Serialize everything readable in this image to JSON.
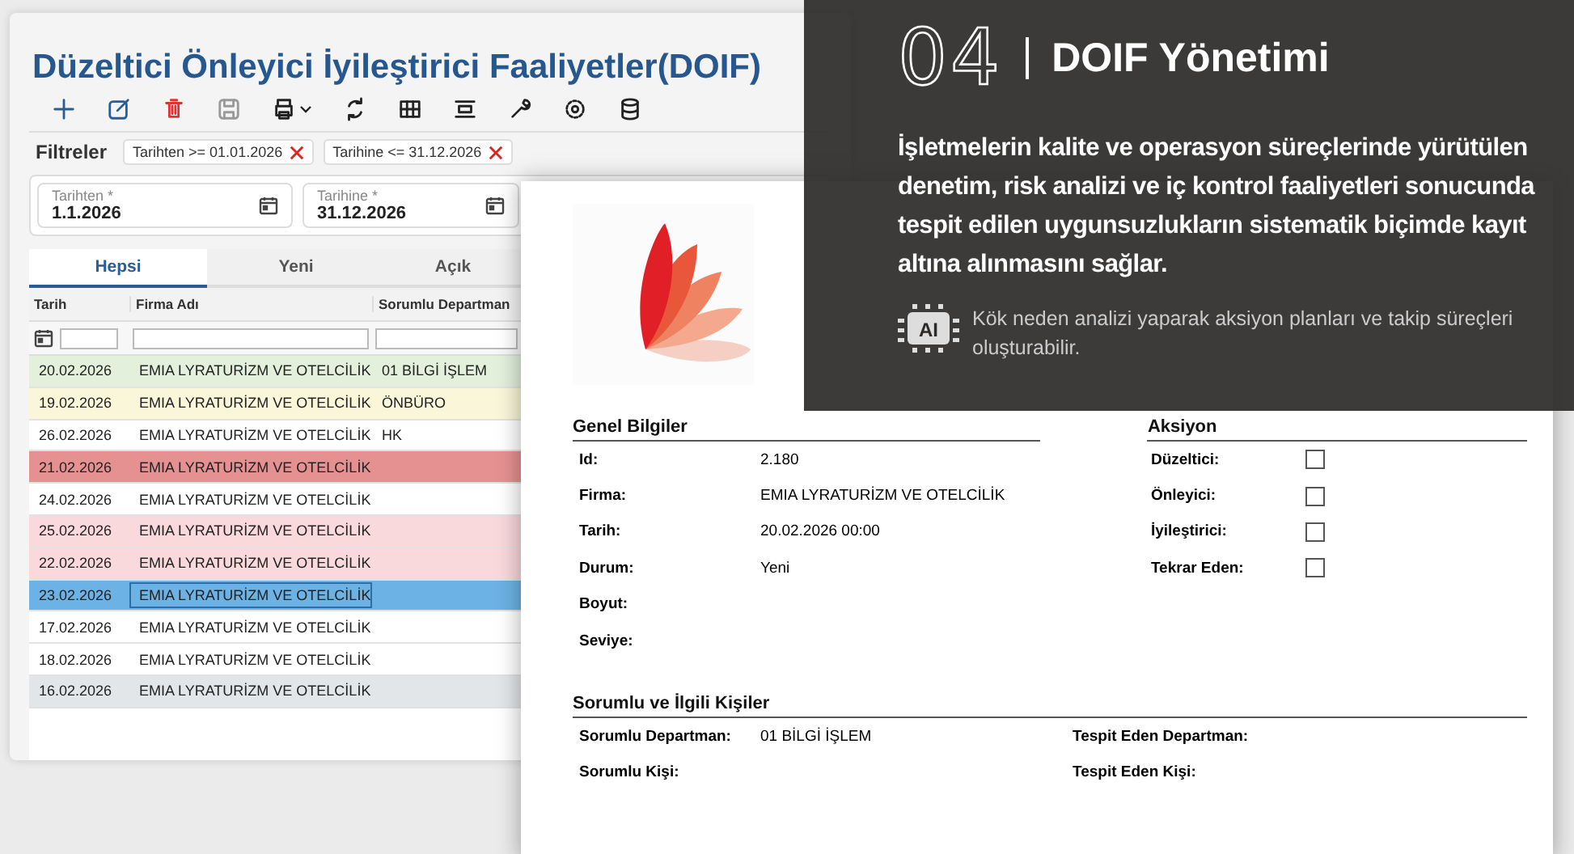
{
  "app": {
    "title": "Düzeltici Önleyici İyileştirici Faaliyetler(DOIF)",
    "filters_label": "Filtreler",
    "filter_chips": [
      "Tarihten >= 01.01.2026",
      "Tarihine <= 31.12.2026"
    ],
    "date_fields": [
      {
        "label": "Tarihten *",
        "value": "1.1.2026"
      },
      {
        "label": "Tarihine *",
        "value": "31.12.2026"
      }
    ],
    "tabs": [
      {
        "label": "Hepsi",
        "selected": true
      },
      {
        "label": "Yeni",
        "selected": false
      },
      {
        "label": "Açık",
        "selected": false
      }
    ],
    "table": {
      "columns": [
        "Tarih",
        "Firma Adı",
        "Sorumlu Departman"
      ],
      "rows": [
        {
          "date": "20.02.2026",
          "company": "EMIA LYRATURİZM VE OTELCİLİK",
          "department": "01 BİLGİ İŞLEM",
          "color": "#e2f0dc",
          "selected": false
        },
        {
          "date": "19.02.2026",
          "company": "EMIA LYRATURİZM VE OTELCİLİK",
          "department": "ÖNBÜRO",
          "color": "#faf6da",
          "selected": false
        },
        {
          "date": "26.02.2026",
          "company": "EMIA LYRATURİZM VE OTELCİLİK",
          "department": "HK",
          "color": "#ffffff",
          "selected": false
        },
        {
          "date": "21.02.2026",
          "company": "EMIA LYRATURİZM VE OTELCİLİK",
          "color": "#e69191",
          "selected": false
        },
        {
          "date": "24.02.2026",
          "company": "EMIA LYRATURİZM VE OTELCİLİK",
          "color": "#ffffff",
          "selected": false
        },
        {
          "date": "25.02.2026",
          "company": "EMIA LYRATURİZM VE OTELCİLİK",
          "color": "#f9d9dc",
          "selected": false
        },
        {
          "date": "22.02.2026",
          "company": "EMIA LYRATURİZM VE OTELCİLİK",
          "color": "#f9d9dc",
          "selected": false
        },
        {
          "date": "23.02.2026",
          "company": "EMIA LYRATURİZM VE OTELCİLİK",
          "color": "#6cb2e4",
          "selected": true
        },
        {
          "date": "17.02.2026",
          "company": "EMIA LYRATURİZM VE OTELCİLİK",
          "color": "#ffffff",
          "selected": false
        },
        {
          "date": "18.02.2026",
          "company": "EMIA LYRATURİZM VE OTELCİLİK",
          "color": "#ffffff",
          "selected": false
        },
        {
          "date": "16.02.2026",
          "company": "EMIA LYRATURİZM VE OTELCİLİK",
          "color": "#e3e6e9",
          "selected": false
        }
      ]
    }
  },
  "form": {
    "general": {
      "heading": "Genel Bilgiler",
      "fields": [
        {
          "label": "Id:",
          "value": "2.180"
        },
        {
          "label": "Firma:",
          "value": "EMIA LYRATURİZM VE OTELCİLİK"
        },
        {
          "label": "Tarih:",
          "value": "20.02.2026 00:00"
        },
        {
          "label": "Durum:",
          "value": "Yeni"
        },
        {
          "label": "Boyut:"
        },
        {
          "label": "Seviye:"
        }
      ]
    },
    "actions": {
      "heading": "Aksiyon",
      "items": [
        {
          "label": "Düzeltici:",
          "checked": false
        },
        {
          "label": "Önleyici:",
          "checked": false
        },
        {
          "label": "İyileştirici:",
          "checked": false
        },
        {
          "label": "Tekrar Eden:",
          "checked": false
        }
      ]
    },
    "people": {
      "heading": "Sorumlu ve İlgili Kişiler",
      "fields": [
        {
          "label": "Sorumlu Departman:",
          "value": "01 BİLGİ İŞLEM"
        },
        {
          "label": "Tespit Eden Departman:"
        },
        {
          "label": "Sorumlu Kişi:"
        },
        {
          "label": "Tespit Eden Kişi:"
        }
      ]
    }
  },
  "panel": {
    "number": "04",
    "title": "DOIF Yönetimi",
    "description": "İşletmelerin kalite ve operasyon süreçlerinde yürütülen denetim, risk analizi ve iç kontrol faaliyetleri sonucunda tespit edilen uygunsuzlukların sistematik biçimde kayıt altına alınmasını sağlar.",
    "ai_badge": "AI",
    "ai_note": "Kök neden analizi yaparak aksiyon planları ve takip süreçleri oluşturabilir."
  }
}
